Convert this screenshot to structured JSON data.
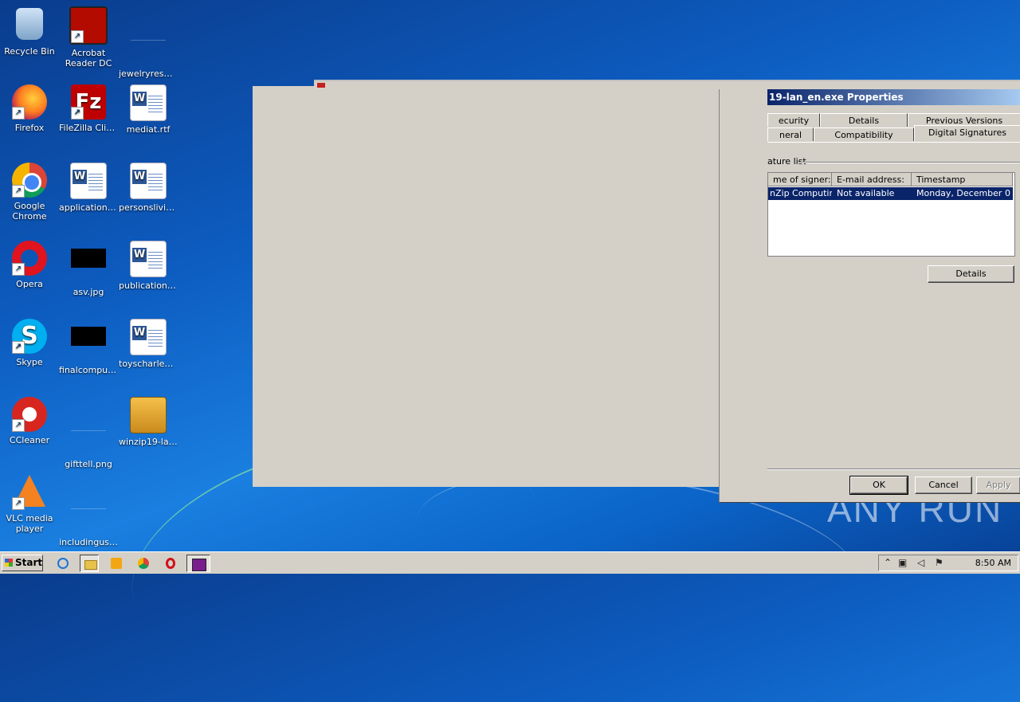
{
  "desktop": {
    "icons": [
      {
        "label": "Recycle Bin",
        "icon": "recycle-bin-icon"
      },
      {
        "label": "Acrobat Reader DC",
        "icon": "acrobat-icon"
      },
      {
        "label": "jewelryresul…",
        "icon": "file-icon"
      },
      {
        "label": "Firefox",
        "icon": "firefox-icon"
      },
      {
        "label": "FileZilla Client",
        "icon": "filezilla-icon"
      },
      {
        "label": "mediat.rtf",
        "icon": "word-document-icon"
      },
      {
        "label": "Google Chrome",
        "icon": "chrome-icon"
      },
      {
        "label": "applications…",
        "icon": "word-document-icon"
      },
      {
        "label": "personslivin…",
        "icon": "word-document-icon"
      },
      {
        "label": "Opera",
        "icon": "opera-icon"
      },
      {
        "label": "asv.jpg",
        "icon": "image-thumbnail-icon"
      },
      {
        "label": "publicationc…",
        "icon": "word-document-icon"
      },
      {
        "label": "Skype",
        "icon": "skype-icon"
      },
      {
        "label": "finalcomput…",
        "icon": "image-thumbnail-icon"
      },
      {
        "label": "toyscharles.rtf",
        "icon": "word-document-icon"
      },
      {
        "label": "CCleaner",
        "icon": "ccleaner-icon"
      },
      {
        "label": "gifttell.png",
        "icon": "image-thumbnail-icon"
      },
      {
        "label": "winzip19-lan…",
        "icon": "winzip-icon"
      },
      {
        "label": "VLC media player",
        "icon": "vlc-icon"
      },
      {
        "label": "includingus…",
        "icon": "image-thumbnail-icon"
      }
    ],
    "watermark": "ANY RUN"
  },
  "dialog": {
    "title": "19-lan_en.exe Properties",
    "tabs_row1": [
      "ecurity",
      "Details",
      "Previous Versions"
    ],
    "tabs_row2": [
      "neral",
      "Compatibility",
      "Digital Signatures"
    ],
    "active_tab": "Digital Signatures",
    "group_label": "ature list",
    "signature_list": {
      "columns": [
        "me of signer:",
        "E-mail address:",
        "Timestamp"
      ],
      "rows": [
        {
          "signer": "nZip Computing",
          "email": "Not available",
          "timestamp": "Monday, December 0…"
        }
      ]
    },
    "details_button": "Details",
    "ok_button": "OK",
    "cancel_button": "Cancel",
    "apply_button": "Apply"
  },
  "taskbar": {
    "start_label": "Start",
    "clock": "8:50 AM"
  }
}
